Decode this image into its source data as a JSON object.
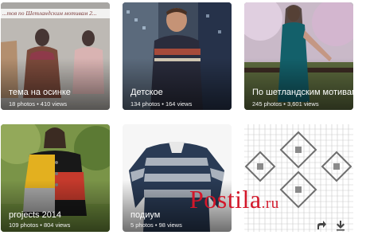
{
  "albums": [
    {
      "title": "тема на осинке",
      "photos": "18",
      "views": "410",
      "banner": "...тоя по Шетландским мотивам 2..."
    },
    {
      "title": "Детское",
      "photos": "134",
      "views": "164"
    },
    {
      "title": "По шетландским мотивам",
      "photos": "245",
      "views": "3,601"
    },
    {
      "title": "projects 2014",
      "photos": "109",
      "views": "804"
    },
    {
      "title": "подиум",
      "photos": "5",
      "photos_suffix": "photos",
      "views": "98"
    },
    {
      "title": "",
      "photos": "",
      "views": ""
    }
  ],
  "labels": {
    "photos": "photos",
    "views": "views"
  },
  "watermark": {
    "main": "Postila",
    "suffix": ".ru"
  },
  "icons": {
    "share": "share-icon",
    "download": "download-icon"
  },
  "colors": {
    "watermark": "#d3172a"
  }
}
